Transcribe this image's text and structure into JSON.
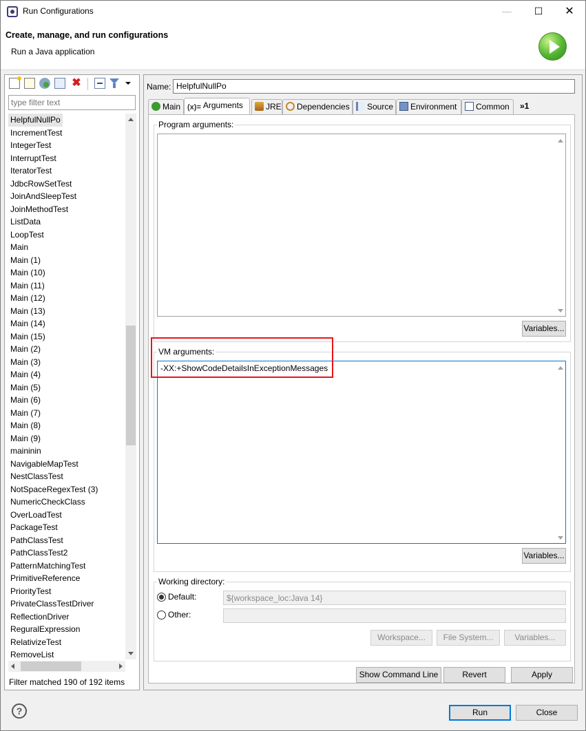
{
  "window": {
    "title": "Run Configurations"
  },
  "header": {
    "title": "Create, manage, and run configurations",
    "subtitle": "Run a Java application"
  },
  "left": {
    "filter_placeholder": "type filter text",
    "items": [
      "HelpfulNullPo",
      "IncrementTest",
      "IntegerTest",
      "InterruptTest",
      "IteratorTest",
      "JdbcRowSetTest",
      "JoinAndSleepTest",
      "JoinMethodTest",
      "ListData",
      "LoopTest",
      "Main",
      "Main (1)",
      "Main (10)",
      "Main (11)",
      "Main (12)",
      "Main (13)",
      "Main (14)",
      "Main (15)",
      "Main (2)",
      "Main (3)",
      "Main (4)",
      "Main (5)",
      "Main (6)",
      "Main (7)",
      "Main (8)",
      "Main (9)",
      "maininin",
      "NavigableMapTest",
      "NestClassTest",
      "NotSpaceRegexTest (3)",
      "NumericCheckClass",
      "OverLoadTest",
      "PackageTest",
      "PathClassTest",
      "PathClassTest2",
      "PatternMatchingTest",
      "PrimitiveReference",
      "PriorityTest",
      "PrivateClassTestDriver",
      "ReflectionDriver",
      "ReguralExpression",
      "RelativizeTest",
      "RemoveList"
    ],
    "selected_index": 0,
    "status": "Filter matched 190 of 192 items"
  },
  "config": {
    "name_label": "Name:",
    "name_value": "HelpfulNullPo",
    "tabs": [
      {
        "label": "Main",
        "icon": "main-class-icon"
      },
      {
        "label": "Arguments",
        "icon": "arguments-icon"
      },
      {
        "label": "JRE",
        "icon": "jre-icon"
      },
      {
        "label": "Dependencies",
        "icon": "dependencies-icon"
      },
      {
        "label": "Source",
        "icon": "source-icon"
      },
      {
        "label": "Environment",
        "icon": "environment-icon"
      },
      {
        "label": "Common",
        "icon": "common-icon"
      }
    ],
    "args_icon_text": "(x)=",
    "tabs_more": "»1",
    "active_tab": "Arguments",
    "program_args_label": "Program arguments:",
    "program_args_value": "",
    "variables_label": "Variables...",
    "vm_args_label": "VM arguments:",
    "vm_args_value": "-XX:+ShowCodeDetailsInExceptionMessages",
    "working_dir_label": "Working directory:",
    "default_label": "Default:",
    "default_value": "${workspace_loc:Java 14}",
    "other_label": "Other:",
    "workspace_btn": "Workspace...",
    "filesystem_btn": "File System...",
    "wd_variables_btn": "Variables..."
  },
  "actions": {
    "show_command_line": "Show Command Line",
    "revert": "Revert",
    "apply": "Apply",
    "run": "Run",
    "close": "Close"
  },
  "colors": {
    "highlight": "#e8141a",
    "focus": "#0078d7"
  }
}
